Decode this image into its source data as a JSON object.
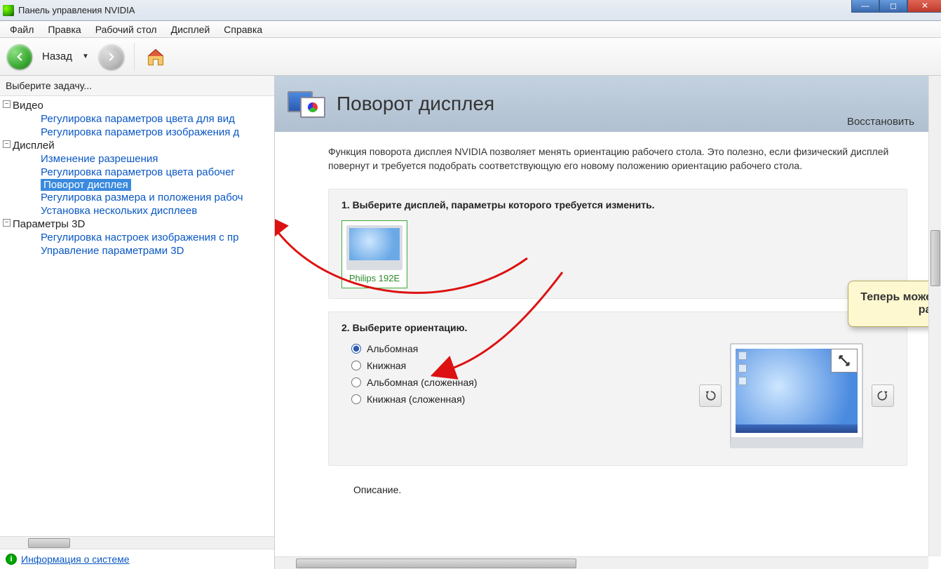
{
  "window": {
    "title": "Панель управления NVIDIA"
  },
  "menu": {
    "file": "Файл",
    "edit": "Правка",
    "desktop": "Рабочий стол",
    "display": "Дисплей",
    "help": "Справка"
  },
  "toolbar": {
    "back": "Назад"
  },
  "sidebar": {
    "header": "Выберите задачу...",
    "video": {
      "label": "Видео",
      "items": [
        "Регулировка параметров цвета для вид",
        "Регулировка параметров изображения д"
      ]
    },
    "display": {
      "label": "Дисплей",
      "items": [
        "Изменение разрешения",
        "Регулировка параметров цвета рабочег",
        "Поворот дисплея",
        "Регулировка размера и положения рабоч",
        "Установка нескольких дисплеев"
      ]
    },
    "params3d": {
      "label": "Параметры 3D",
      "items": [
        "Регулировка настроек изображения с пр",
        "Управление параметрами 3D"
      ]
    },
    "footer": "Информация о системе"
  },
  "page": {
    "title": "Поворот дисплея",
    "restore": "Восстановить",
    "intro": "Функция поворота дисплея NVIDIA позволяет менять ориентацию рабочего стола. Это полезно, если физический дисплей повернут и требуется подобрать соответствующую его новому положению ориентацию рабочего стола.",
    "step1_title": "1. Выберите дисплей, параметры которого требуется изменить.",
    "monitor_name": "Philips 192E",
    "step2_title": "2. Выберите ориентацию.",
    "orientations": [
      "Альбомная",
      "Книжная",
      "Альбомная (сложенная)",
      "Книжная (сложенная)"
    ],
    "selected_orientation": 0,
    "description_label": "Описание."
  },
  "callout": "Теперь можете с легкостью выполнить разворот десплея!"
}
